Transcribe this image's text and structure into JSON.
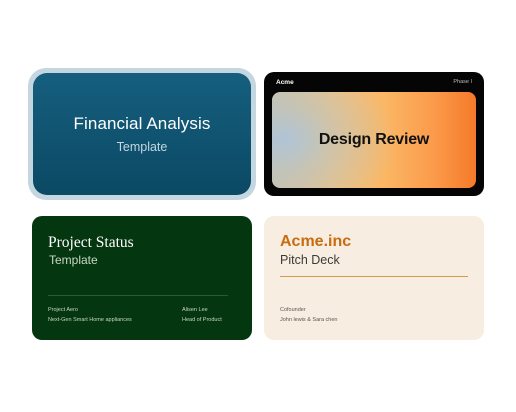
{
  "cards": [
    {
      "title": "Financial Analysis",
      "subtitle": "Template"
    },
    {
      "brand": "Acme",
      "phase": "Phase I",
      "title": "Design Review"
    },
    {
      "title": "Project Status",
      "subtitle": "Template",
      "project_label": "Project Aero",
      "project_desc": "Next-Gen Smart Home appliances",
      "person_name": "Alisen Lee",
      "person_role": "Head of Product"
    },
    {
      "title": "Acme.inc",
      "subtitle": "Pitch Deck",
      "role_label": "Cofounder",
      "names": "John lewis & Sara chen"
    }
  ],
  "colors": {
    "financial_bg": "#0f5674",
    "selected_ring": "#c4d6df",
    "design_bg": "#050505",
    "project_bg": "#04360f",
    "acme_bg": "#f8ede1",
    "acme_accent": "#c96b0e"
  }
}
